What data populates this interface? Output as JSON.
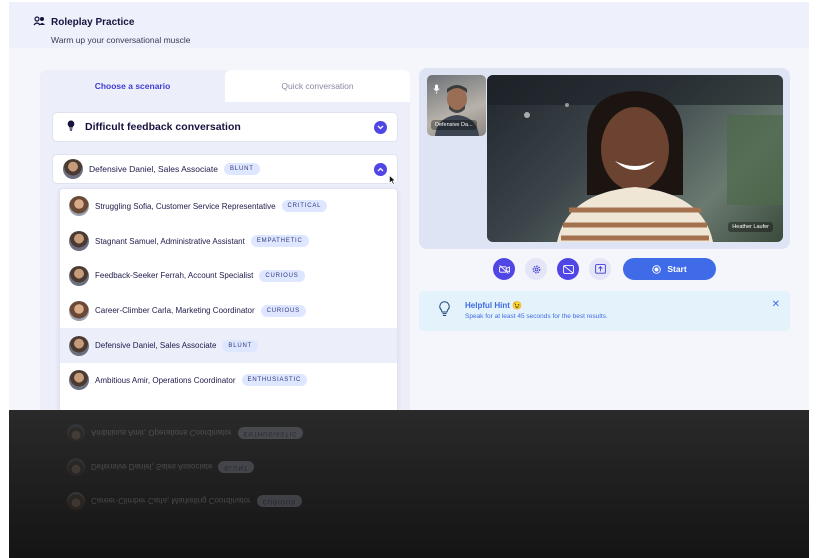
{
  "header": {
    "title": "Roleplay Practice",
    "subtitle": "Warm up your conversational muscle"
  },
  "tabs": [
    {
      "label": "Choose a scenario",
      "active": true
    },
    {
      "label": "Quick conversation",
      "active": false
    }
  ],
  "scenario": {
    "label": "Difficult feedback conversation"
  },
  "persona_select": {
    "label": "Defensive Daniel, Sales Associate",
    "badge": "BLUNT"
  },
  "options": [
    {
      "label": "Struggling Sofia, Customer Service Representative",
      "badge": "CRITICAL"
    },
    {
      "label": "Stagnant Samuel, Administrative Assistant",
      "badge": "EMPATHETIC"
    },
    {
      "label": "Feedback-Seeker Ferrah, Account Specialist",
      "badge": "CURIOUS"
    },
    {
      "label": "Career-Climber Carla, Marketing Coordinator",
      "badge": "CURIOUS"
    },
    {
      "label": "Defensive Daniel, Sales Associate",
      "badge": "BLUNT"
    },
    {
      "label": "Ambitious Amir, Operations Coordinator",
      "badge": "ENTHUSIASTIC"
    }
  ],
  "reflection": [
    {
      "label": "Ambitious Amir, Operations Coordinator",
      "badge": "ENTHUSIASTIC"
    },
    {
      "label": "Defensive Daniel, Sales Associate",
      "badge": "BLUNT"
    },
    {
      "label": "Career-Climber Carla, Marketing Coordinator",
      "badge": "CURIOUS"
    }
  ],
  "video": {
    "main_label": "Heather Laufer",
    "pip_label": "Defensive Da..."
  },
  "controls": {
    "start_label": "Start"
  },
  "hint": {
    "title": "Helpful Hint 😉",
    "body": "Speak for at least 45 seconds for the best results."
  },
  "colors": {
    "accent": "#4f46e5",
    "start": "#3f6be8",
    "hint_bg": "#e4f3fb"
  }
}
